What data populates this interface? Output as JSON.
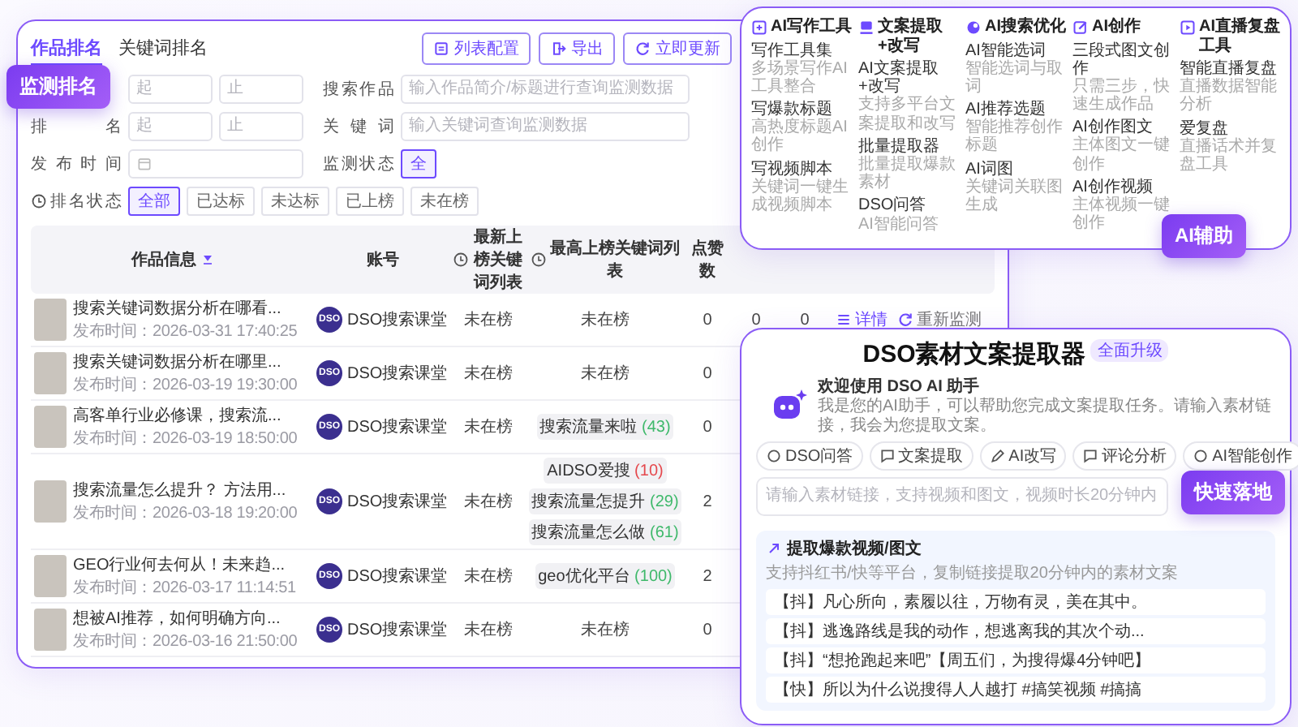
{
  "monitor_badge": "监测排名",
  "monitor": {
    "tabs": [
      {
        "label": "作品排名",
        "selected": true
      },
      {
        "label": "关键词排名",
        "selected": false
      }
    ],
    "buttons": [
      {
        "kind": "config",
        "label": "列表配置"
      },
      {
        "kind": "export",
        "label": "导出"
      },
      {
        "kind": "refresh",
        "label": "立即更新"
      }
    ],
    "filter_rows": [
      [
        {
          "kind": "range",
          "from_placeholder": "起",
          "to_placeholder": "止"
        },
        {
          "kind": "text",
          "label": "搜索作品",
          "placeholder": "输入作品简介/标题进行查询监测数据"
        }
      ],
      [
        {
          "kind": "range",
          "label": "排名",
          "from_placeholder": "起",
          "to_placeholder": "止"
        },
        {
          "kind": "text",
          "label": "关键词",
          "placeholder": "输入关键词查询监测数据"
        }
      ],
      [
        {
          "kind": "date",
          "label": "发布时间"
        },
        {
          "kind": "choice",
          "label": "监测状态",
          "info": false,
          "options": [
            {
              "label": "全",
              "selected": true
            }
          ]
        }
      ],
      [
        {
          "kind": "choice",
          "label": "排名状态",
          "info": true,
          "options": [
            {
              "label": "全部",
              "selected": true
            },
            {
              "label": "已达标",
              "selected": false
            },
            {
              "label": "未达标",
              "selected": false
            },
            {
              "label": "已上榜",
              "selected": false
            },
            {
              "label": "未在榜",
              "selected": false
            }
          ]
        }
      ]
    ],
    "table": {
      "columns": [
        {
          "label": "作品信息",
          "sortable": true,
          "info": false
        },
        {
          "label": "账号",
          "sortable": false,
          "info": false
        },
        {
          "label": "最新上榜关键词列表",
          "sortable": false,
          "info": true
        },
        {
          "label": "最高上榜关键词列表",
          "sortable": false,
          "info": true
        },
        {
          "label": "点赞数",
          "sortable": false,
          "info": false
        }
      ],
      "rows": [
        {
          "title": "搜索关键词数据分析在哪看...",
          "published": "发布时间：2026-03-31 17:40:25",
          "account": {
            "logo": "DSO",
            "name": "DSO搜索课堂"
          },
          "latest": "未在榜",
          "highest_status": "未在榜",
          "likes": "0",
          "extra_cells": [
            "0",
            "0"
          ],
          "actions": [
            {
              "kind": "detail",
              "label": "详情"
            },
            {
              "kind": "refresh",
              "label": "重新监测"
            }
          ]
        },
        {
          "title": "搜索关键词数据分析在哪里...",
          "published": "发布时间：2026-03-19 19:30:00",
          "account": {
            "logo": "DSO",
            "name": "DSO搜索课堂"
          },
          "latest": "未在榜",
          "highest_status": "未在榜",
          "likes": "0"
        },
        {
          "title": "高客单行业必修课，搜索流...",
          "published": "发布时间：2026-03-19 18:50:00",
          "account": {
            "logo": "DSO",
            "name": "DSO搜索课堂"
          },
          "latest": "未在榜",
          "highest_tags": [
            {
              "text": "搜索流量来啦",
              "count": "(43)",
              "color": "#3fb96b"
            }
          ],
          "likes": "0"
        },
        {
          "title": "搜索流量怎么提升？ 方法用...",
          "published": "发布时间：2026-03-18 19:20:00",
          "account": {
            "logo": "DSO",
            "name": "DSO搜索课堂"
          },
          "latest": "未在榜",
          "highest_tags": [
            {
              "text": "AIDSO爱搜",
              "count": "(10)",
              "color": "#e5484d"
            },
            {
              "text": "搜索流量怎提升",
              "count": "(29)",
              "color": "#3fb96b"
            },
            {
              "text": "搜索流量怎么做",
              "count": "(61)",
              "color": "#3fb96b"
            }
          ],
          "likes": "2"
        },
        {
          "title": "GEO行业何去何从！未来趋...",
          "published": "发布时间：2026-03-17 11:14:51",
          "account": {
            "logo": "DSO",
            "name": "DSO搜索课堂"
          },
          "latest": "未在榜",
          "highest_tags": [
            {
              "text": "geo优化平台",
              "count": "(100)",
              "color": "#3fb96b"
            }
          ],
          "likes": "2"
        },
        {
          "title": "想被AI推荐，如何明确方向...",
          "published": "发布时间：2026-03-16 21:50:00",
          "account": {
            "logo": "DSO",
            "name": "DSO搜索课堂"
          },
          "latest": "未在榜",
          "highest_status": "未在榜",
          "likes": "0"
        }
      ]
    }
  },
  "ai_badge": "AI辅助",
  "ai_tools": [
    {
      "kind": "write",
      "title": "AI写作工具",
      "items": [
        {
          "name": "写作工具集",
          "description": "多场景写作AI工具整合"
        },
        {
          "name": "写爆款标题",
          "description": "高热度标题AI创作"
        },
        {
          "name": "写视频脚本",
          "description": "关键词一键生成视频脚本"
        }
      ]
    },
    {
      "kind": "extract",
      "title": "文案提取+改写",
      "items": [
        {
          "name": "AI文案提取+改写",
          "description": "支持多平台文案提取和改写"
        },
        {
          "name": "批量提取器",
          "description": "批量提取爆款素材"
        },
        {
          "name": "DSO问答",
          "description": "AI智能问答"
        }
      ]
    },
    {
      "kind": "search",
      "title": "AI搜索优化",
      "items": [
        {
          "name": "AI智能选词",
          "description": "智能选词与取词"
        },
        {
          "name": "AI推荐选题",
          "description": "智能推荐创作标题"
        },
        {
          "name": "AI词图",
          "description": "关键词关联图生成"
        }
      ]
    },
    {
      "kind": "create",
      "title": "AI创作",
      "items": [
        {
          "name": "三段式图文创作",
          "description": "只需三步，快速生成作品"
        },
        {
          "name": "AI创作图文",
          "description": "主体图文一键创作"
        },
        {
          "name": "AI创作视频",
          "description": "主体视频一键创作"
        }
      ]
    },
    {
      "kind": "live",
      "title": "AI直播复盘工具",
      "items": [
        {
          "name": "智能直播复盘",
          "description": "直播数据智能分析"
        },
        {
          "name": "爱复盘",
          "description": "直播话术并复盘工具"
        }
      ]
    }
  ],
  "fast_badge": "快速落地",
  "extractor": {
    "title": "DSO素材文案提取器",
    "tag": "全面升级",
    "welcome_title": "欢迎使用 DSO AI 助手",
    "welcome_text": "我是您的AI助手，可以帮助您完成文案提取任务。请输入素材链接，我会为您提取文案。",
    "chips": [
      {
        "kind": "qa",
        "label": "DSO问答"
      },
      {
        "kind": "extract",
        "label": "文案提取"
      },
      {
        "kind": "rewrite",
        "label": "AI改写"
      },
      {
        "kind": "comment",
        "label": "评论分析"
      },
      {
        "kind": "create",
        "label": "AI智能创作"
      }
    ],
    "input_placeholder": "请输入素材链接，支持视频和图文，视频时长20分钟内",
    "section_title": "提取爆款视频/图文",
    "section_subtitle": "支持抖红书/快等平台，复制链接提取20分钟内的素材文案",
    "examples": [
      "【抖】凡心所向，素履以往，万物有灵，美在其中。",
      "【抖】逃逸路线是我的动作，想逃离我的其次个动...",
      "【抖】“想抢跑起来吧”【周五们，为搜得爆4分钟吧】",
      "【快】所以为什么说搜得人人越打 #搞笑视频 #搞搞"
    ]
  }
}
